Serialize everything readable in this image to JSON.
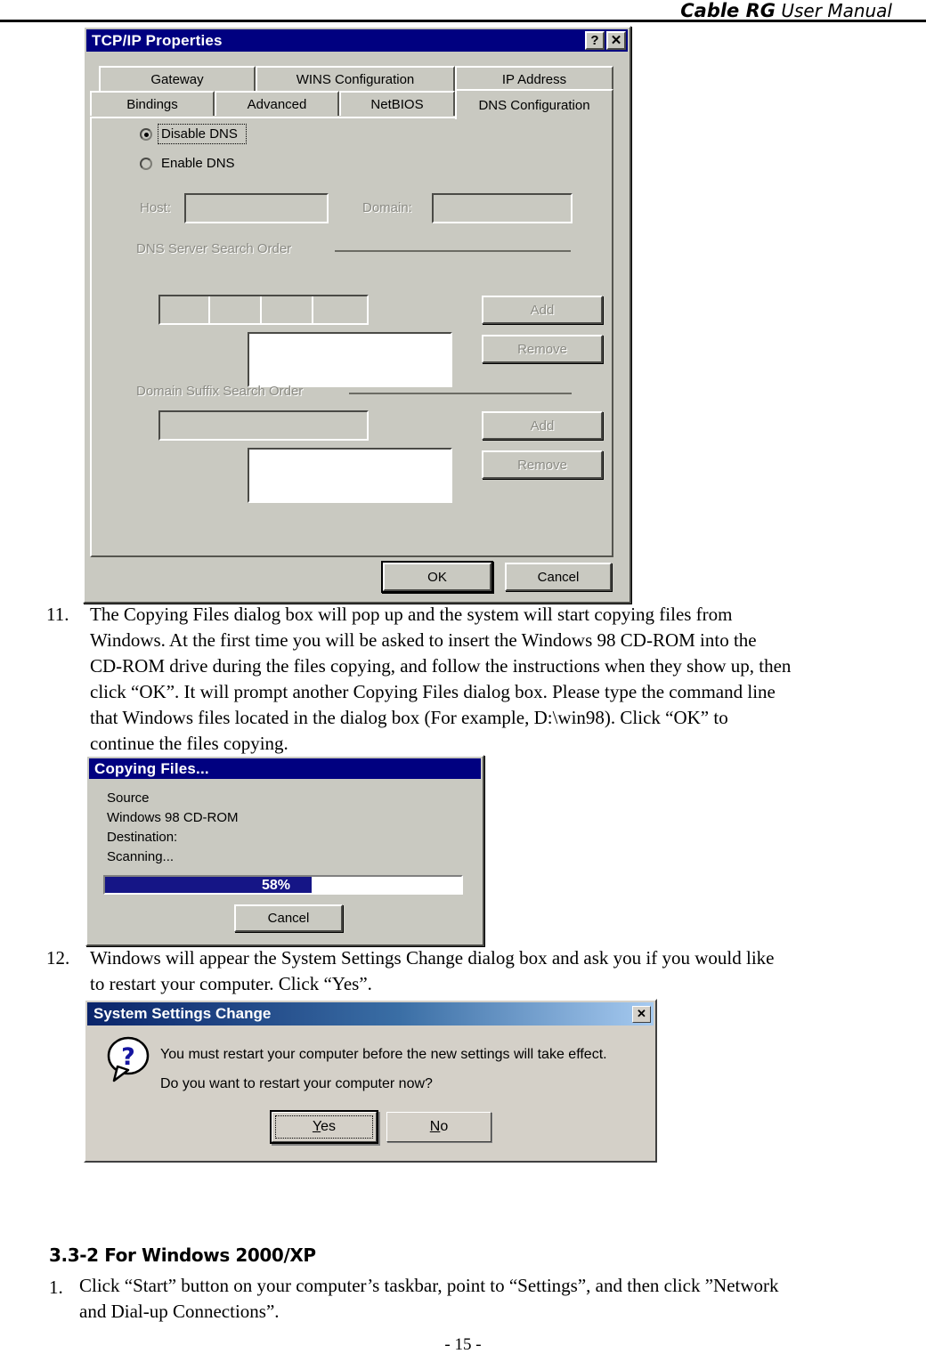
{
  "header": {
    "title_strong": "Cable RG",
    "title_rest": " User Manual"
  },
  "tcpip_dialog": {
    "title": "TCP/IP Properties",
    "help_button": "?",
    "close_button": "✕",
    "tabs_row1": [
      "Gateway",
      "WINS Configuration",
      "IP Address"
    ],
    "tabs_row2": [
      "Bindings",
      "Advanced",
      "NetBIOS",
      "DNS Configuration"
    ],
    "active_tab": "DNS Configuration",
    "radio_disable_dns": "Disable DNS",
    "radio_enable_dns": "Enable DNS",
    "selected_radio": "Disable DNS",
    "host_label": "Host:",
    "host_value": "",
    "domain_label": "Domain:",
    "domain_value": "",
    "dns_group_label": "DNS Server Search Order",
    "dns_add_button": "Add",
    "dns_remove_button": "Remove",
    "dns_list_items": [],
    "suffix_group_label": "Domain Suffix Search Order",
    "suffix_add_button": "Add",
    "suffix_remove_button": "Remove",
    "suffix_list_items": [],
    "ok_button": "OK",
    "cancel_button": "Cancel"
  },
  "step11": {
    "number": "11.",
    "lines": [
      "The Copying Files dialog box will pop up and the system will start copying files from",
      "Windows. At the first time you will be asked to insert the Windows 98 CD-ROM into the",
      "CD-ROM drive during the files copying, and follow the instructions when they show up, then",
      "click “OK”. It will prompt another Copying Files dialog box. Please type the command line",
      "that Windows files located in the dialog box (For example, D:\\win98). Click “OK” to",
      "continue the files copying."
    ]
  },
  "copying_dialog": {
    "title": "Copying Files...",
    "source_label": "Source",
    "source_value": "Windows 98 CD-ROM",
    "destination_label": "Destination:",
    "status": "Scanning...",
    "progress_percent": 58,
    "progress_label": "58%",
    "cancel_button": "Cancel"
  },
  "step12": {
    "number": "12.",
    "lines": [
      "Windows will appear the System Settings Change dialog box and ask you if you would like",
      "to restart your computer. Click “Yes”."
    ]
  },
  "system_settings_dialog": {
    "title": "System Settings Change",
    "close_button": "✕",
    "icon": "question-bubble-icon",
    "message_line1": "You must restart your computer before the new settings will take effect.",
    "message_line2": "Do you want to restart your computer now?",
    "yes_button_prefix": "",
    "yes_button_mnemonic": "Y",
    "yes_button_suffix": "es",
    "no_button_mnemonic": "N",
    "no_button_suffix": "o",
    "default_button": "Yes"
  },
  "section": {
    "heading": "3.3-2 For Windows 2000/XP",
    "step1_number": "1.",
    "step1_lines": [
      "Click “Start” button on your computer’s taskbar, point to “Settings”, and then click ”Network",
      "and Dial-up Connections”."
    ]
  },
  "footer": {
    "page_number": "- 15 -"
  }
}
